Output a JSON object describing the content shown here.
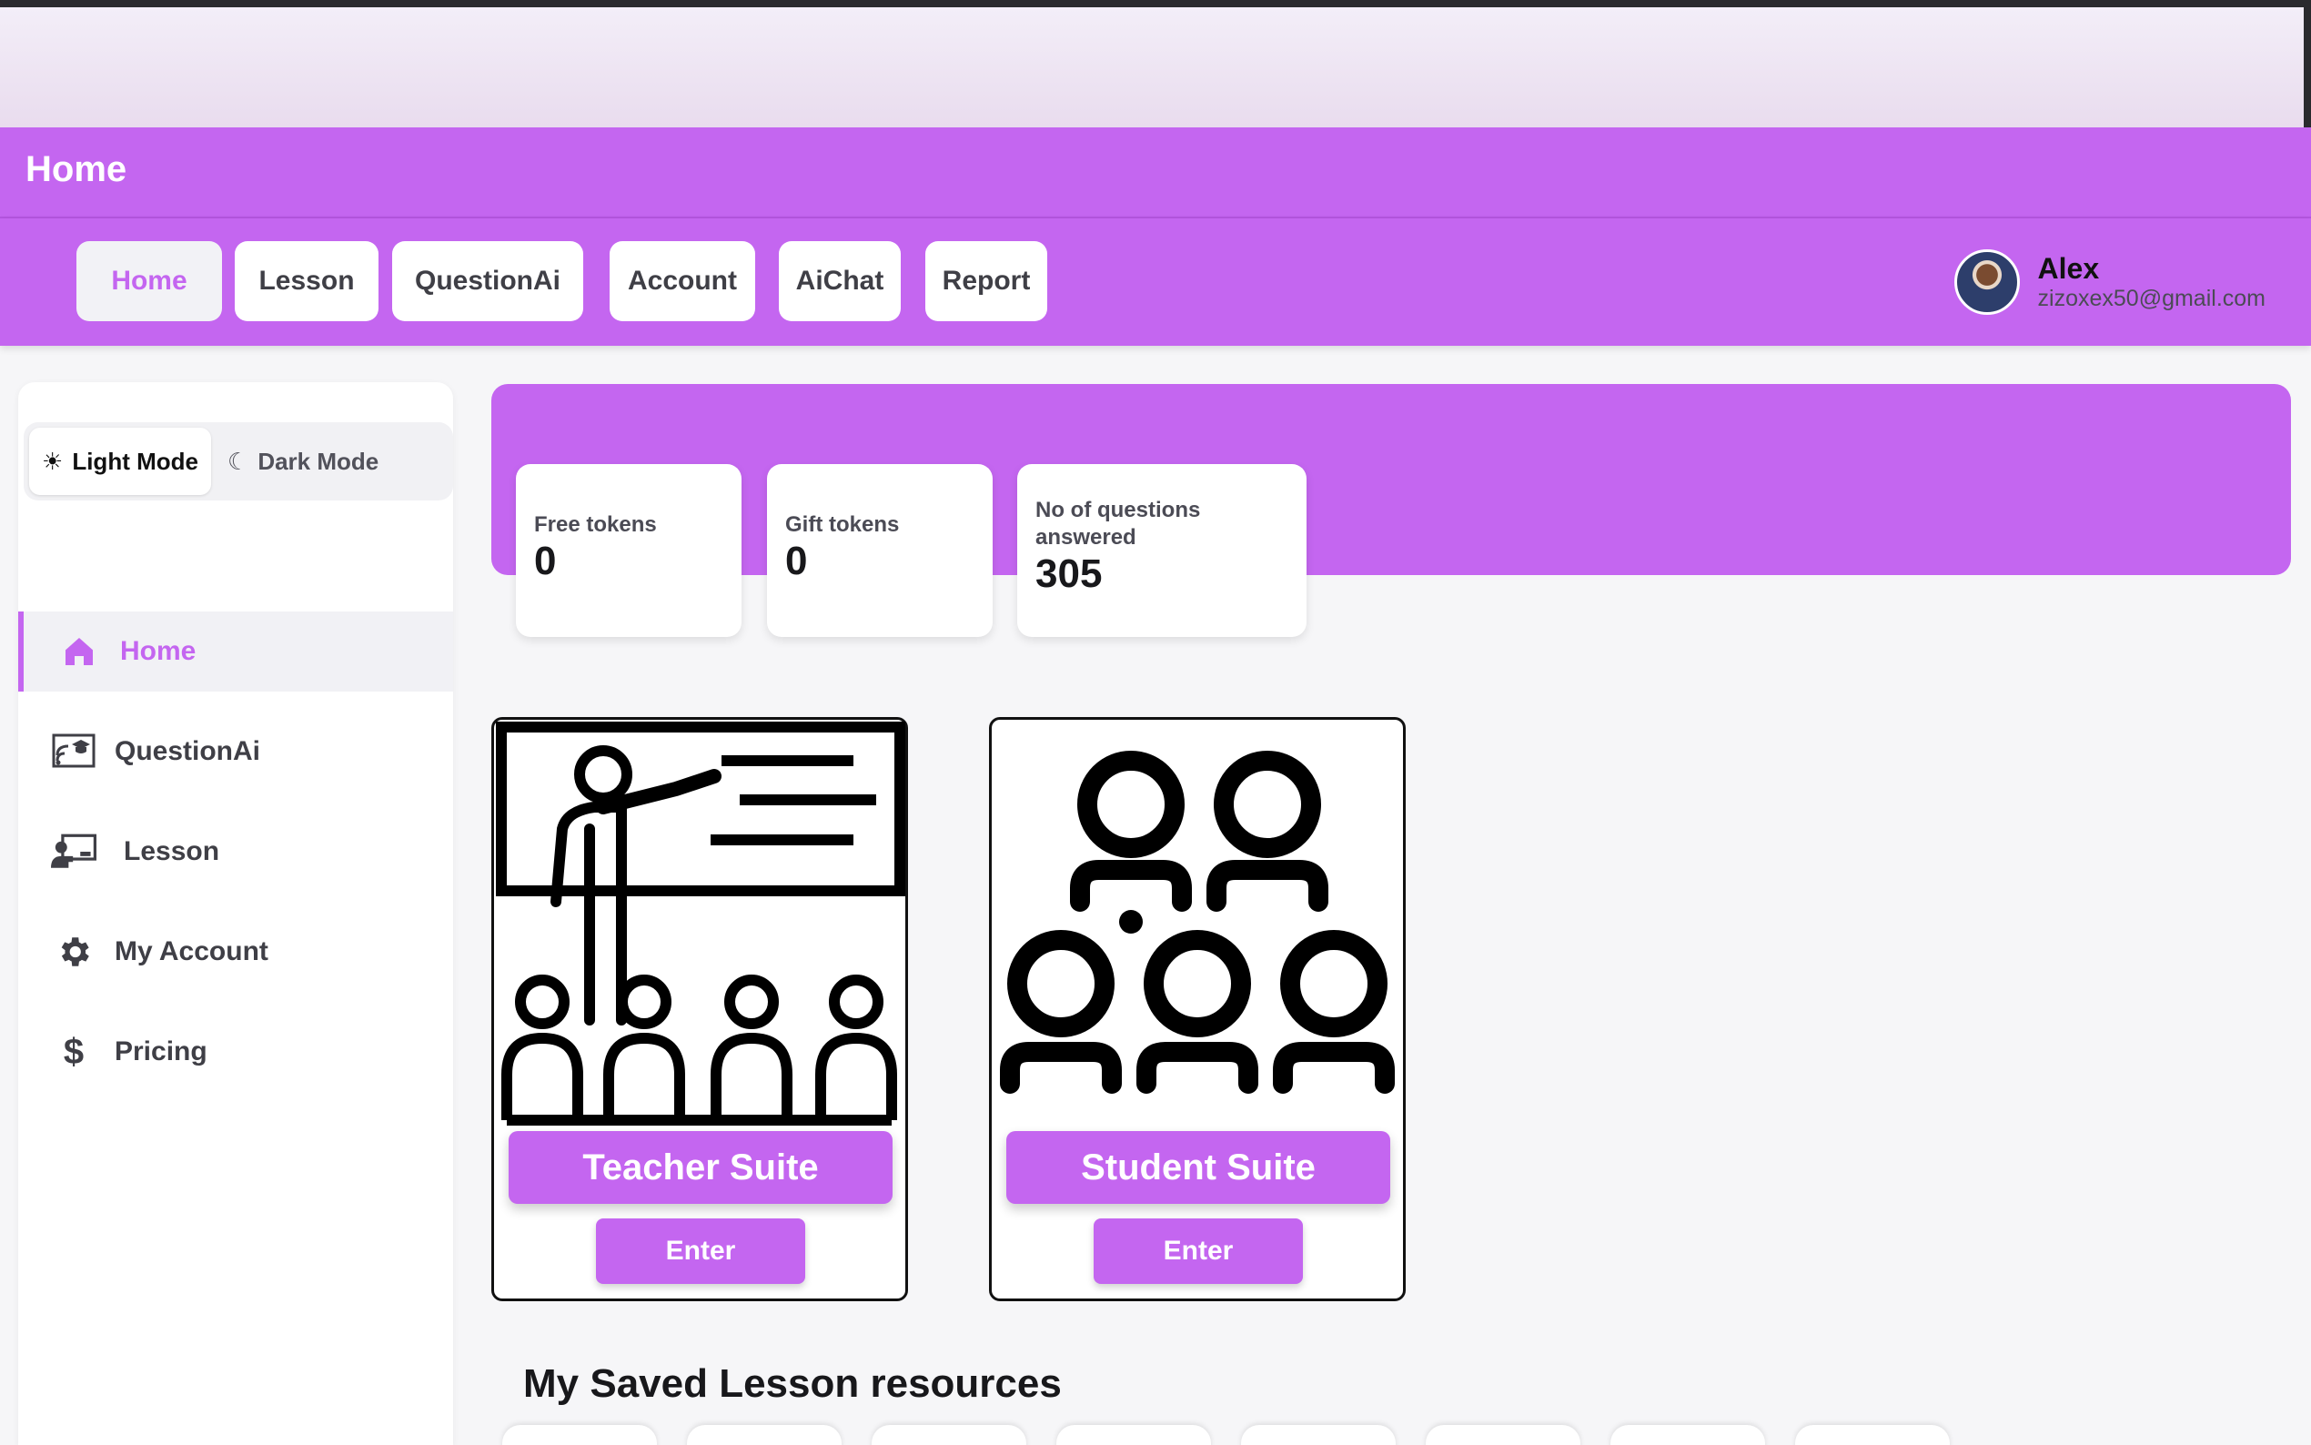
{
  "page_title": "Home",
  "nav": {
    "items": [
      {
        "label": "Home",
        "active": true
      },
      {
        "label": "Lesson"
      },
      {
        "label": "QuestionAi"
      },
      {
        "label": "Account"
      },
      {
        "label": "AiChat"
      },
      {
        "label": "Report"
      }
    ]
  },
  "user": {
    "name": "Alex",
    "email": "zizoxex50@gmail.com"
  },
  "theme_toggle": {
    "light_label": "Light Mode",
    "dark_label": "Dark Mode",
    "selected": "Light Mode"
  },
  "sidebar": {
    "items": [
      {
        "label": "Home",
        "icon": "home-icon",
        "active": true
      },
      {
        "label": "QuestionAi",
        "icon": "question-ai-icon"
      },
      {
        "label": "Lesson",
        "icon": "lesson-icon"
      },
      {
        "label": "My Account",
        "icon": "gear-icon"
      },
      {
        "label": "Pricing",
        "icon": "dollar-icon"
      }
    ]
  },
  "stats": [
    {
      "label": "Free tokens",
      "value": "0"
    },
    {
      "label": "Gift tokens",
      "value": "0"
    },
    {
      "label": "No of questions answered",
      "value": "305"
    }
  ],
  "suites": [
    {
      "title": "Teacher Suite",
      "button": "Enter",
      "icon": "teacher-classroom-icon"
    },
    {
      "title": "Student Suite",
      "button": "Enter",
      "icon": "student-group-icon"
    }
  ],
  "saved_section": {
    "title": "My Saved Lesson resources"
  },
  "colors": {
    "accent": "#c466f0",
    "active_bg": "#f1f1f5"
  }
}
